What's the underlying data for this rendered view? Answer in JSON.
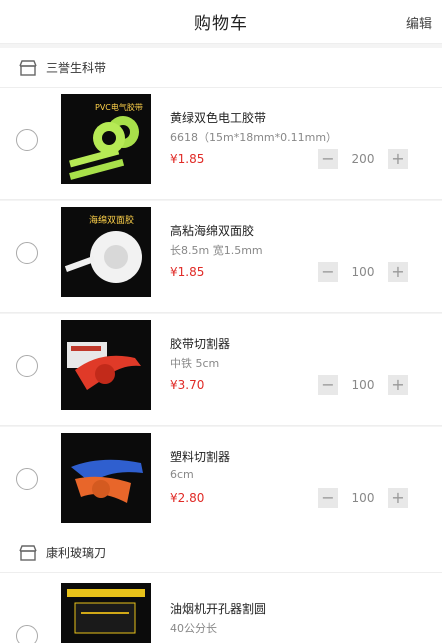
{
  "navbar": {
    "title": "购物车",
    "edit_label": "编辑"
  },
  "shops": [
    {
      "name": "三誉生科带"
    },
    {
      "name": "康利玻璃刀"
    }
  ],
  "items": [
    {
      "name": "黄绿双色电工胶带",
      "spec": "6618（15m*18mm*0.11mm）",
      "price": "¥1.85",
      "quantity": "200",
      "thumb_label": "PVC电气胶带"
    },
    {
      "name": "高粘海绵双面胶",
      "spec": "长8.5m 宽1.5mm",
      "price": "¥1.85",
      "quantity": "100",
      "thumb_label": "海绵双面胶"
    },
    {
      "name": "胶带切割器",
      "spec": "中铁 5cm",
      "price": "¥3.70",
      "quantity": "100",
      "thumb_label": ""
    },
    {
      "name": "塑料切割器",
      "spec": "6cm",
      "price": "¥2.80",
      "quantity": "100",
      "thumb_label": ""
    },
    {
      "name": "油烟机开孔器割圆",
      "spec": "40公分长",
      "price": "",
      "quantity": "",
      "thumb_label": ""
    }
  ],
  "stepper": {
    "minus": "−",
    "plus": "+"
  },
  "colors": {
    "price": "#e02b27",
    "background": "#f4f4f4"
  }
}
